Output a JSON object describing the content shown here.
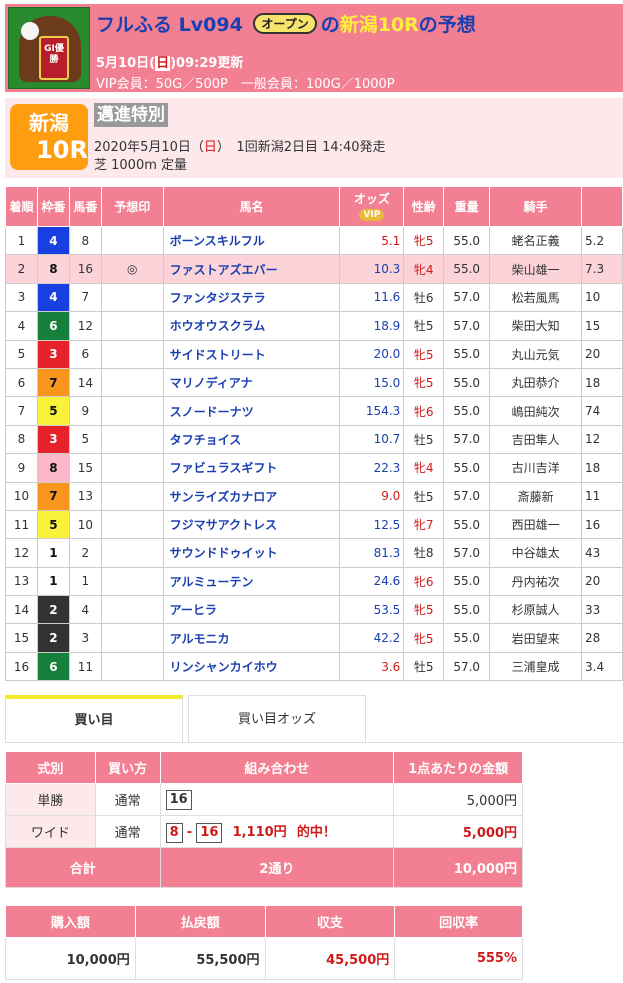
{
  "header": {
    "user": "フルふる",
    "level": "Lv094",
    "rank": "オープン",
    "title_mid": "の",
    "race_ref": "新潟10R",
    "title_end": "の予想",
    "updated_pre": "5月10日(",
    "updated_day": "日",
    "updated_post": ")09:29更新",
    "points": "VIP会員：50G／500P　一般会員：100G／1000P",
    "avatar_text": "GI優勝"
  },
  "race": {
    "place": "新潟",
    "number": "10R",
    "name": "邁進特別",
    "date_pre": "2020年5月10日（",
    "date_day": "日",
    "date_post": "）　1回新潟2日目 14:40発走",
    "course": "芝 1000m 定量"
  },
  "entries_header": {
    "rank": "着順",
    "frame": "枠番",
    "num": "馬番",
    "mark": "予想印",
    "name": "馬名",
    "odds": "オッズ",
    "odds_badge": "VIP",
    "sex": "性齢",
    "weight": "重量",
    "jockey": "騎手"
  },
  "entries": [
    {
      "rank": "1",
      "frame": "4",
      "num": "8",
      "mark": "",
      "name": "ボーンスキルフル",
      "odds": "5.1",
      "sex": "牝5",
      "weight": "55.0",
      "jockey": "蛯名正義",
      "pop": "5.2"
    },
    {
      "rank": "2",
      "frame": "8",
      "num": "16",
      "mark": "◎",
      "name": "ファストアズエバー",
      "odds": "10.3",
      "sex": "牝4",
      "weight": "55.0",
      "jockey": "柴山雄一",
      "pop": "7.3"
    },
    {
      "rank": "3",
      "frame": "4",
      "num": "7",
      "mark": "",
      "name": "ファンタジステラ",
      "odds": "11.6",
      "sex": "牡6",
      "weight": "57.0",
      "jockey": "松若風馬",
      "pop": "10"
    },
    {
      "rank": "4",
      "frame": "6",
      "num": "12",
      "mark": "",
      "name": "ホウオウスクラム",
      "odds": "18.9",
      "sex": "牡5",
      "weight": "57.0",
      "jockey": "柴田大知",
      "pop": "15"
    },
    {
      "rank": "5",
      "frame": "3",
      "num": "6",
      "mark": "",
      "name": "サイドストリート",
      "odds": "20.0",
      "sex": "牝5",
      "weight": "55.0",
      "jockey": "丸山元気",
      "pop": "20"
    },
    {
      "rank": "6",
      "frame": "7",
      "num": "14",
      "mark": "",
      "name": "マリノディアナ",
      "odds": "15.0",
      "sex": "牝5",
      "weight": "55.0",
      "jockey": "丸田恭介",
      "pop": "18"
    },
    {
      "rank": "7",
      "frame": "5",
      "num": "9",
      "mark": "",
      "name": "スノードーナツ",
      "odds": "154.3",
      "sex": "牝6",
      "weight": "55.0",
      "jockey": "嶋田純次",
      "pop": "74"
    },
    {
      "rank": "8",
      "frame": "3",
      "num": "5",
      "mark": "",
      "name": "タフチョイス",
      "odds": "10.7",
      "sex": "牡5",
      "weight": "57.0",
      "jockey": "吉田隼人",
      "pop": "12"
    },
    {
      "rank": "9",
      "frame": "8",
      "num": "15",
      "mark": "",
      "name": "ファビュラスギフト",
      "odds": "22.3",
      "sex": "牝4",
      "weight": "55.0",
      "jockey": "古川吉洋",
      "pop": "18"
    },
    {
      "rank": "10",
      "frame": "7",
      "num": "13",
      "mark": "",
      "name": "サンライズカナロア",
      "odds": "9.0",
      "sex": "牡5",
      "weight": "57.0",
      "jockey": "斎藤新",
      "pop": "11"
    },
    {
      "rank": "11",
      "frame": "5",
      "num": "10",
      "mark": "",
      "name": "フジマサアクトレス",
      "odds": "12.5",
      "sex": "牝7",
      "weight": "55.0",
      "jockey": "西田雄一",
      "pop": "16"
    },
    {
      "rank": "12",
      "frame": "1",
      "num": "2",
      "mark": "",
      "name": "サウンドドゥイット",
      "odds": "81.3",
      "sex": "牡8",
      "weight": "57.0",
      "jockey": "中谷雄太",
      "pop": "43"
    },
    {
      "rank": "13",
      "frame": "1",
      "num": "1",
      "mark": "",
      "name": "アルミューテン",
      "odds": "24.6",
      "sex": "牝6",
      "weight": "55.0",
      "jockey": "丹内祐次",
      "pop": "20"
    },
    {
      "rank": "14",
      "frame": "2",
      "num": "4",
      "mark": "",
      "name": "アーヒラ",
      "odds": "53.5",
      "sex": "牝5",
      "weight": "55.0",
      "jockey": "杉原誠人",
      "pop": "33"
    },
    {
      "rank": "15",
      "frame": "2",
      "num": "3",
      "mark": "",
      "name": "アルモニカ",
      "odds": "42.2",
      "sex": "牝5",
      "weight": "55.0",
      "jockey": "岩田望来",
      "pop": "28"
    },
    {
      "rank": "16",
      "frame": "6",
      "num": "11",
      "mark": "",
      "name": "リンシャンカイホウ",
      "odds": "3.6",
      "sex": "牡5",
      "weight": "57.0",
      "jockey": "三浦皇成",
      "pop": "3.4"
    }
  ],
  "tabs": {
    "bets": "買い目",
    "bet_odds": "買い目オッズ"
  },
  "bets_header": {
    "type": "式別",
    "method": "買い方",
    "combo": "組み合わせ",
    "amount": "1点あたりの金額"
  },
  "bets": [
    {
      "type": "単勝",
      "method": "通常",
      "c1": "16",
      "sep": "",
      "c2": "",
      "payout": "",
      "hit": "",
      "amount": "5,000円"
    },
    {
      "type": "ワイド",
      "method": "通常",
      "c1": "8",
      "sep": "-",
      "c2": "16",
      "payout": "1,110円",
      "hit": "的中！",
      "amount": "5,000円"
    }
  ],
  "bets_total": {
    "label": "合計",
    "count": "2通り",
    "amount": "10,000円"
  },
  "summary_header": {
    "purchase": "購入額",
    "refund": "払戻額",
    "balance": "収支",
    "rate": "回収率"
  },
  "summary": {
    "purchase": "10,000円",
    "refund": "55,500円",
    "balance": "45,500円",
    "rate": "555%"
  }
}
